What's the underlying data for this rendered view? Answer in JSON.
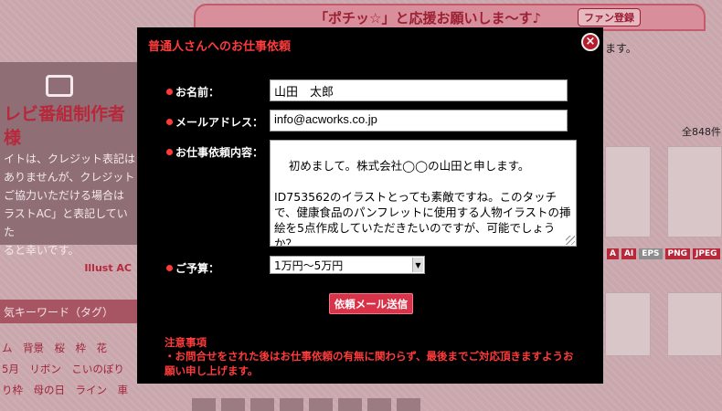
{
  "background": {
    "banner_text": "「ポチッ☆」と応援お願いしま～す♪",
    "fan_button": "ファン登録",
    "right_text": "ます。",
    "count_text": "全848件",
    "left_card": {
      "title": "レビ番組制作者様",
      "lines": [
        "イトは、クレジット表記は",
        "ありませんが、クレジット",
        "ご協力いただける場合は",
        "ラストAC」と表記していた",
        "ると幸いです。"
      ],
      "brand": "Illust AC"
    },
    "keyword_header": "気キーワード（タグ）",
    "tag_lines": [
      "ム　背景　桜　枠　花",
      "5月　リボン　こいのぼり",
      "り枠　母の日　ライン　車"
    ],
    "badges": [
      "A",
      "AI",
      "EPS",
      "PNG",
      "JPEG",
      "AI"
    ]
  },
  "modal": {
    "title": "普通人さんへのお仕事依頼",
    "close_icon": "×",
    "name_label": "お名前：",
    "name_value": "山田　太郎",
    "email_label": "メールアドレス：",
    "email_value": "info@acworks.co.jp",
    "message_label": "お仕事依頼内容：",
    "message_value": "初めまして。株式会社◯◯の山田と申します。\n\nID753562のイラストとっても素敵ですね。このタッチで、健康食品のパンフレットに使用する人物イラストの挿絵を5点作成していただきたいのですが、可能でしょうか？\nお返事お待ちしております。",
    "budget_label": "ご予算：",
    "budget_value": "1万円〜5万円",
    "send_button": "依頼メール送信",
    "notice_title": "注意事項",
    "notice_text": "・お問合せをされた後はお仕事依頼の有無に関わらず、最後までご対応頂きますようお願い申し上げます。"
  },
  "colors": {
    "accent": "#ff3b3b",
    "button": "#d9334a",
    "modal_bg": "#000000"
  }
}
